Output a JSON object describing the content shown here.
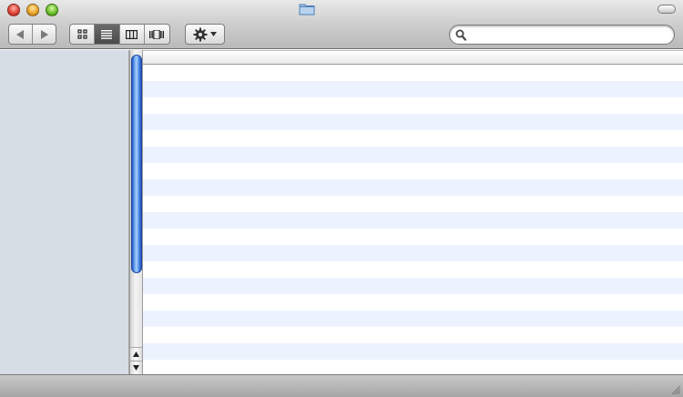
{
  "window": {
    "title": "",
    "icon": "folder-icon"
  },
  "toolbar": {
    "nav_buttons": [
      {
        "name": "back",
        "icon": "triangle-left-icon"
      },
      {
        "name": "forward",
        "icon": "triangle-right-icon"
      }
    ],
    "view_buttons": [
      {
        "name": "icon-view",
        "icon": "grid-icon",
        "active": false
      },
      {
        "name": "list-view",
        "icon": "list-lines-icon",
        "active": true
      },
      {
        "name": "column-view",
        "icon": "columns-icon",
        "active": false
      },
      {
        "name": "cover-flow-view",
        "icon": "coverflow-icon",
        "active": false
      }
    ],
    "action_button": {
      "icon": "gear-icon",
      "menu_indicator": "chevron-down-icon"
    },
    "search": {
      "placeholder": "",
      "value": "",
      "icon": "search-icon"
    }
  },
  "sidebar": {
    "items": []
  },
  "list": {
    "columns": [],
    "rows": []
  },
  "status_bar": {
    "text": ""
  },
  "colors": {
    "sidebar_bg": "#d6dde5",
    "row_stripe": "#edf3fe",
    "scroll_thumb": "#3b7be6"
  }
}
